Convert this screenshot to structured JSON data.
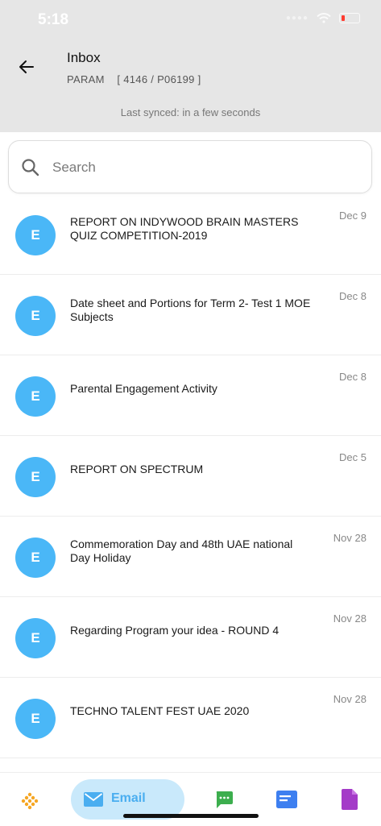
{
  "status_bar": {
    "time": "5:18"
  },
  "header": {
    "title": "Inbox",
    "subtitle": "PARAM    [ 4146 / P06199 ]",
    "synced": "Last synced: in a few seconds"
  },
  "search": {
    "placeholder": "Search"
  },
  "messages": [
    {
      "initial": "E",
      "subject": "REPORT ON INDYWOOD BRAIN MASTERS QUIZ COMPETITION-2019",
      "date": "Dec 9"
    },
    {
      "initial": "E",
      "subject": "Date sheet and Portions for Term 2- Test 1 MOE Subjects",
      "date": "Dec 8"
    },
    {
      "initial": "E",
      "subject": "Parental Engagement Activity",
      "date": "Dec 8"
    },
    {
      "initial": "E",
      "subject": "REPORT ON SPECTRUM",
      "date": "Dec 5"
    },
    {
      "initial": "E",
      "subject": "Commemoration Day and 48th UAE national Day Holiday",
      "date": "Nov 28"
    },
    {
      "initial": "E",
      "subject": "Regarding Program your idea - ROUND 4",
      "date": "Nov 28"
    },
    {
      "initial": "E",
      "subject": "TECHNO TALENT FEST UAE 2020",
      "date": "Nov 28"
    }
  ],
  "bottom_nav": {
    "email_label": "Email",
    "icons": [
      "dots-grid-icon",
      "email-icon",
      "chat-icon",
      "card-icon",
      "document-icon"
    ]
  },
  "colors": {
    "header_bg": "#e6e6e6",
    "avatar": "#4ab7f7",
    "email_pill": "#c9e9fb",
    "email_accent": "#4aaef0",
    "chat": "#3cae4e",
    "card": "#3d7ff0",
    "document": "#a43bc8",
    "dots": "#f5a623"
  }
}
